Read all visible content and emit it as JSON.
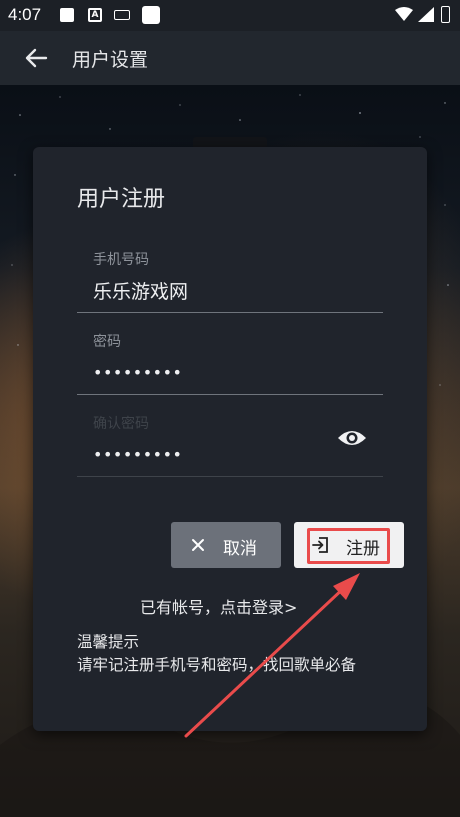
{
  "status_bar": {
    "time": "4:07",
    "icons": [
      "notification-square-icon",
      "a-badge-icon",
      "keyboard-icon",
      "app-square-icon",
      "wifi-icon",
      "signal-icon",
      "battery-icon"
    ]
  },
  "app_bar": {
    "title": "用户设置",
    "back_icon": "arrow-left-icon"
  },
  "card": {
    "title": "用户注册",
    "fields": {
      "phone": {
        "label": "手机号码",
        "value": "乐乐游戏网"
      },
      "password": {
        "label": "密码",
        "value": "•••••••••"
      },
      "confirm": {
        "label": "确认密码",
        "value": "•••••••••"
      }
    },
    "buttons": {
      "cancel": "取消",
      "register": "注册"
    },
    "login_link": "已有帐号，点击登录>",
    "tip_title": "温馨提示",
    "tip_body": "请牢记注册手机号和密码，找回歌单必备"
  },
  "colors": {
    "card_bg": "#20242c",
    "app_bar_bg": "#22272e",
    "highlight": "#e94b4b",
    "cancel_btn": "#6c717a",
    "register_btn": "#f1f1f2"
  }
}
